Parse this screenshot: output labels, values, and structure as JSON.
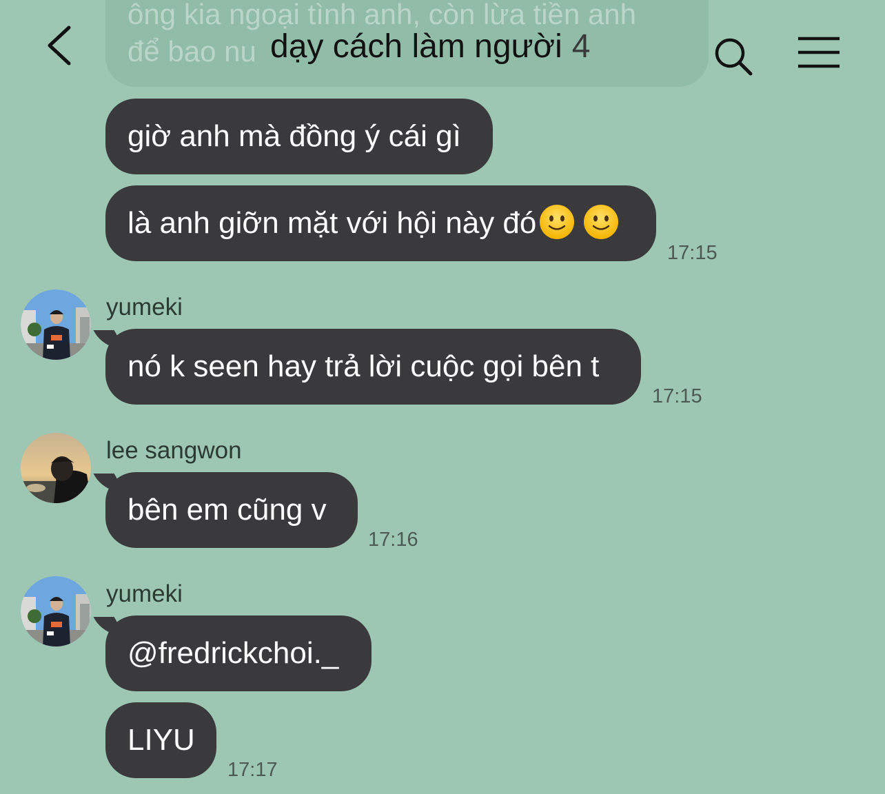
{
  "header": {
    "title": "dạy cách làm người",
    "member_count": "4",
    "back_icon": "chevron-left-icon",
    "search_icon": "search-icon",
    "menu_icon": "hamburger-menu-icon"
  },
  "faded_message": {
    "line1": "ông kia ngoại tình anh, còn lừa tiền anh",
    "line2": "để bao nu"
  },
  "messages": [
    {
      "text": "giờ anh mà đồng ý cái gì"
    },
    {
      "text": "là anh giỡn mặt với hội này đó",
      "emoji": "slightly-smiling-face x2",
      "time": "17:15"
    },
    {
      "sender": "yumeki",
      "text": "nó k seen hay trả lời cuộc gọi bên t",
      "time": "17:15"
    },
    {
      "sender": "lee sangwon",
      "text": "bên em cũng v",
      "time": "17:16"
    },
    {
      "sender": "yumeki",
      "text": "@fredrickchoi._"
    },
    {
      "text": "LIYU",
      "time": "17:17"
    }
  ],
  "colors": {
    "background": "#9dc6b3",
    "bubble": "#3a3a3c",
    "bubble_text": "#ffffff",
    "timestamp": "#4c5a54"
  }
}
